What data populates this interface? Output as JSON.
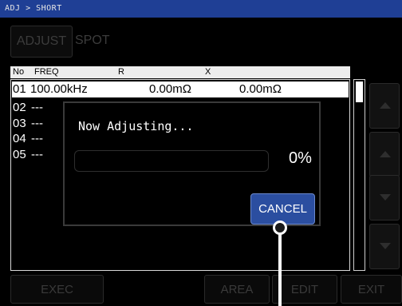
{
  "title_bar": {
    "path": "ADJ > SHORT"
  },
  "mode_buttons": {
    "adjust": "ADJUST",
    "spot": "SPOT"
  },
  "table": {
    "headers": {
      "no": "No",
      "freq": "FREQ",
      "r": "R",
      "x": "X"
    },
    "rows": [
      {
        "no": "01",
        "freq": "100.00kHz",
        "r": "0.00mΩ",
        "x": "0.00mΩ"
      },
      {
        "no": "02",
        "freq": "---"
      },
      {
        "no": "03",
        "freq": "---"
      },
      {
        "no": "04",
        "freq": "---"
      },
      {
        "no": "05",
        "freq": "---"
      }
    ]
  },
  "dialog": {
    "message": "Now Adjusting...",
    "progress": 0,
    "progress_text": "0%",
    "cancel_label": "CANCEL"
  },
  "bottom_buttons": {
    "exec": "EXEC",
    "area": "AREA",
    "edit": "EDIT",
    "exit": "EXIT"
  },
  "colors": {
    "title_bar": "#1f3f95",
    "cancel_button": "#2b4ea0",
    "progress_fill": "#4f8fd9"
  }
}
